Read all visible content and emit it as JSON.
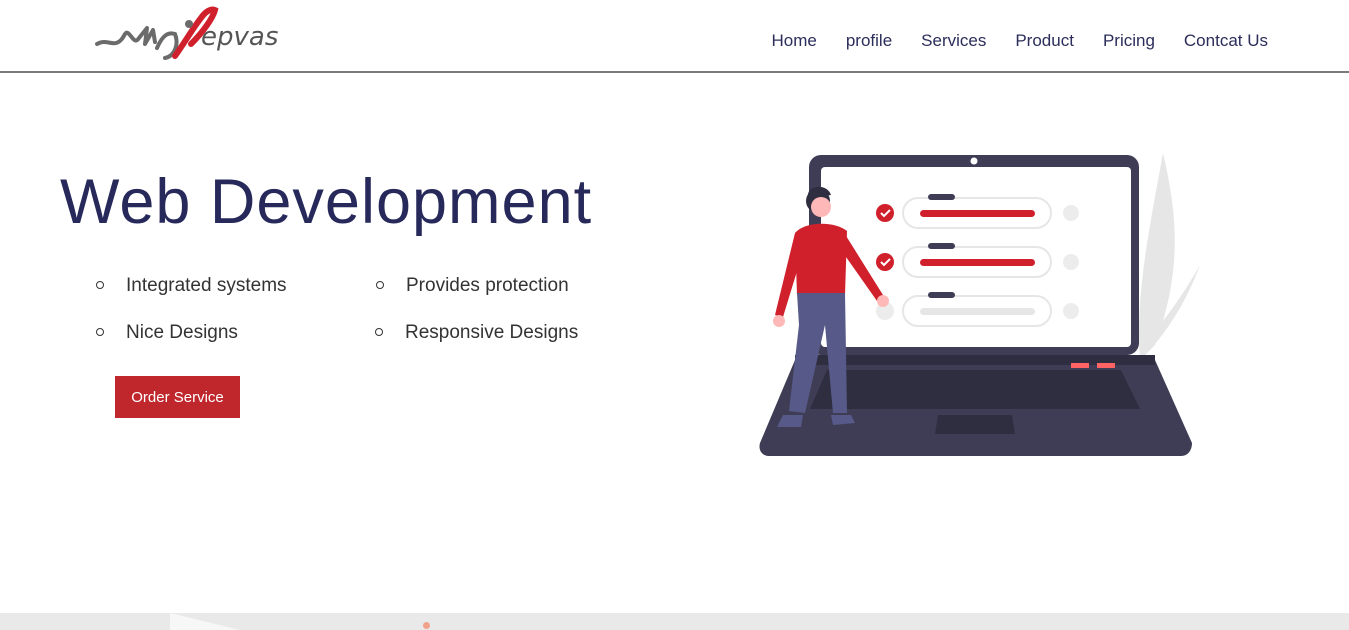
{
  "header": {
    "logo_text": "epvas",
    "nav": [
      "Home",
      "profile",
      "Services",
      "Product",
      "Pricing",
      "Contcat Us"
    ]
  },
  "hero": {
    "title": "Web Development",
    "features": [
      "Integrated systems",
      "Provides protection",
      "Nice Designs",
      "Responsive Designs"
    ],
    "cta_label": "Order Service"
  },
  "colors": {
    "accent": "#c0272d",
    "title": "#26295a",
    "laptop": "#3f3d56"
  }
}
